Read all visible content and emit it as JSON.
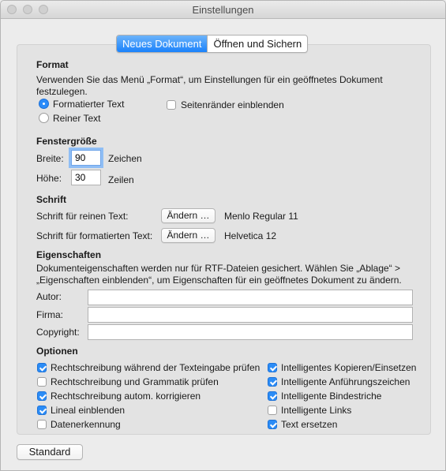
{
  "window": {
    "title": "Einstellungen",
    "controls": [
      "close-button",
      "minimize-button",
      "zoom-button"
    ]
  },
  "tabs": [
    {
      "label": "Neues Dokument",
      "selected": true
    },
    {
      "label": "Öffnen und Sichern",
      "selected": false
    }
  ],
  "format": {
    "heading": "Format",
    "description": "Verwenden Sie das Menü „Format“, um Einstellungen für ein geöffnetes Dokument festzulegen.",
    "options": [
      {
        "label": "Formatierter Text",
        "selected": true
      },
      {
        "label": "Reiner Text",
        "selected": false
      }
    ],
    "page_margins": {
      "label": "Seitenränder einblenden",
      "checked": false
    }
  },
  "window_size": {
    "heading": "Fenstergröße",
    "width_label": "Breite:",
    "width_value": "90",
    "width_unit": "Zeichen",
    "height_label": "Höhe:",
    "height_value": "30",
    "height_unit": "Zeilen"
  },
  "font": {
    "heading": "Schrift",
    "plain_label": "Schrift für reinen Text:",
    "plain_button": "Ändern …",
    "plain_value": "Menlo Regular 11",
    "rich_label": "Schrift für formatierten Text:",
    "rich_button": "Ändern …",
    "rich_value": "Helvetica 12"
  },
  "properties": {
    "heading": "Eigenschaften",
    "description": "Dokumenteigenschaften werden nur für RTF-Dateien gesichert. Wählen Sie „Ablage“ > „Eigenschaften einblenden“, um Eigenschaften für ein geöffnetes Dokument zu ändern.",
    "author_label": "Autor:",
    "author_value": "",
    "company_label": "Firma:",
    "company_value": "",
    "copyright_label": "Copyright:",
    "copyright_value": ""
  },
  "options": {
    "heading": "Optionen",
    "left": [
      {
        "label": "Rechtschreibung während der Texteingabe prüfen",
        "checked": true
      },
      {
        "label": "Rechtschreibung und Grammatik prüfen",
        "checked": false
      },
      {
        "label": "Rechtschreibung autom. korrigieren",
        "checked": true
      },
      {
        "label": "Lineal einblenden",
        "checked": true
      },
      {
        "label": "Datenerkennung",
        "checked": false
      }
    ],
    "right": [
      {
        "label": "Intelligentes Kopieren/Einsetzen",
        "checked": true
      },
      {
        "label": "Intelligente Anführungszeichen",
        "checked": true
      },
      {
        "label": "Intelligente Bindestriche",
        "checked": true
      },
      {
        "label": "Intelligente Links",
        "checked": false
      },
      {
        "label": "Text ersetzen",
        "checked": true
      }
    ]
  },
  "footer": {
    "default_button": "Standard"
  },
  "colors": {
    "accent": "#1a82fb",
    "checkbox_on": "#2b8cf6",
    "window_bg": "#ececec"
  }
}
